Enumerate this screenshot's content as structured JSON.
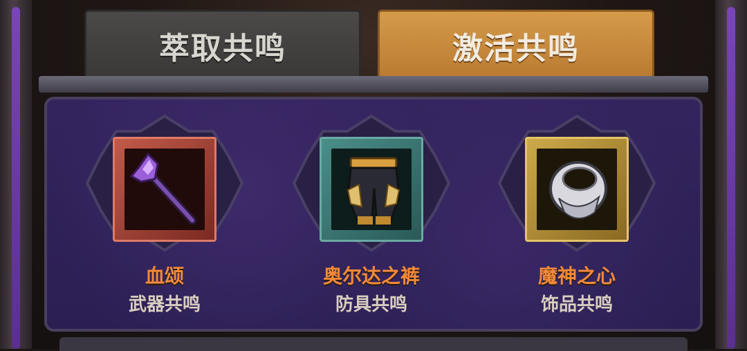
{
  "tabs": [
    {
      "label": "萃取共鸣",
      "active": false
    },
    {
      "label": "激活共鸣",
      "active": true
    }
  ],
  "items": [
    {
      "name": "血颂",
      "type": "武器共鸣",
      "icon": "mace-icon",
      "frame_color": "#c25a4a"
    },
    {
      "name": "奥尔达之裤",
      "type": "防具共鸣",
      "icon": "pants-icon",
      "frame_color": "#4a8e8a"
    },
    {
      "name": "魔神之心",
      "type": "饰品共鸣",
      "icon": "ring-icon",
      "frame_color": "#cdaa4a"
    }
  ],
  "colors": {
    "item_name": "#f28a3a",
    "active_tab": "#d59a4a",
    "panel": "#34245e"
  }
}
